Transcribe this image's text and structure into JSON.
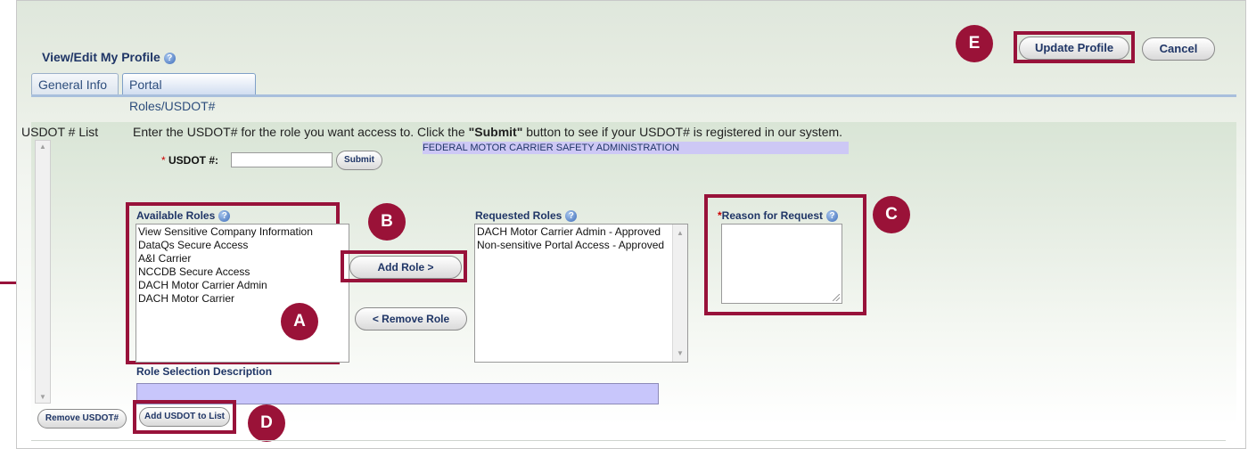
{
  "header": {
    "title": "View/Edit My Profile",
    "tabs": [
      {
        "label": "General Info",
        "active": false
      },
      {
        "label": "Portal Roles/USDOT#",
        "active": true
      }
    ],
    "update_profile_label": "Update Profile",
    "cancel_label": "Cancel"
  },
  "usdot": {
    "list_label": "USDOT # List",
    "instruction_pre": "Enter the USDOT# for the role you want access to. Click the ",
    "instruction_bold": "\"Submit\"",
    "instruction_post": " button to see if your USDOT# is registered in our system.",
    "field_required_mark": "*",
    "field_label": "USDOT #:",
    "field_value": "",
    "submit_label": "Submit",
    "agency_name": "FEDERAL MOTOR CARRIER SAFETY ADMINISTRATION",
    "remove_label": "Remove USDOT#",
    "add_label": "Add USDOT to List"
  },
  "roles": {
    "available_label": "Available Roles",
    "available": [
      "View Sensitive Company Information",
      "DataQs Secure Access",
      "A&I Carrier",
      "NCCDB Secure Access",
      "DACH Motor Carrier Admin",
      "DACH Motor Carrier"
    ],
    "add_role_label": "Add Role >",
    "remove_role_label": "< Remove Role",
    "requested_label": "Requested Roles",
    "requested": [
      "DACH Motor Carrier Admin - Approved",
      "Non-sensitive Portal Access - Approved"
    ],
    "reason_required_mark": "*",
    "reason_label": "Reason for Request",
    "reason_value": "",
    "description_label": "Role Selection Description",
    "description_value": ""
  },
  "callouts": {
    "a": "A",
    "b": "B",
    "c": "C",
    "d": "D",
    "e": "E"
  },
  "colors": {
    "callout": "#9a1238",
    "highlight_box": "#98123a",
    "heading_text": "#1f3566",
    "agency_bar": "#cdc8f5",
    "description_bar": "#c8c6fb"
  },
  "icons": {
    "help": "help-icon"
  }
}
